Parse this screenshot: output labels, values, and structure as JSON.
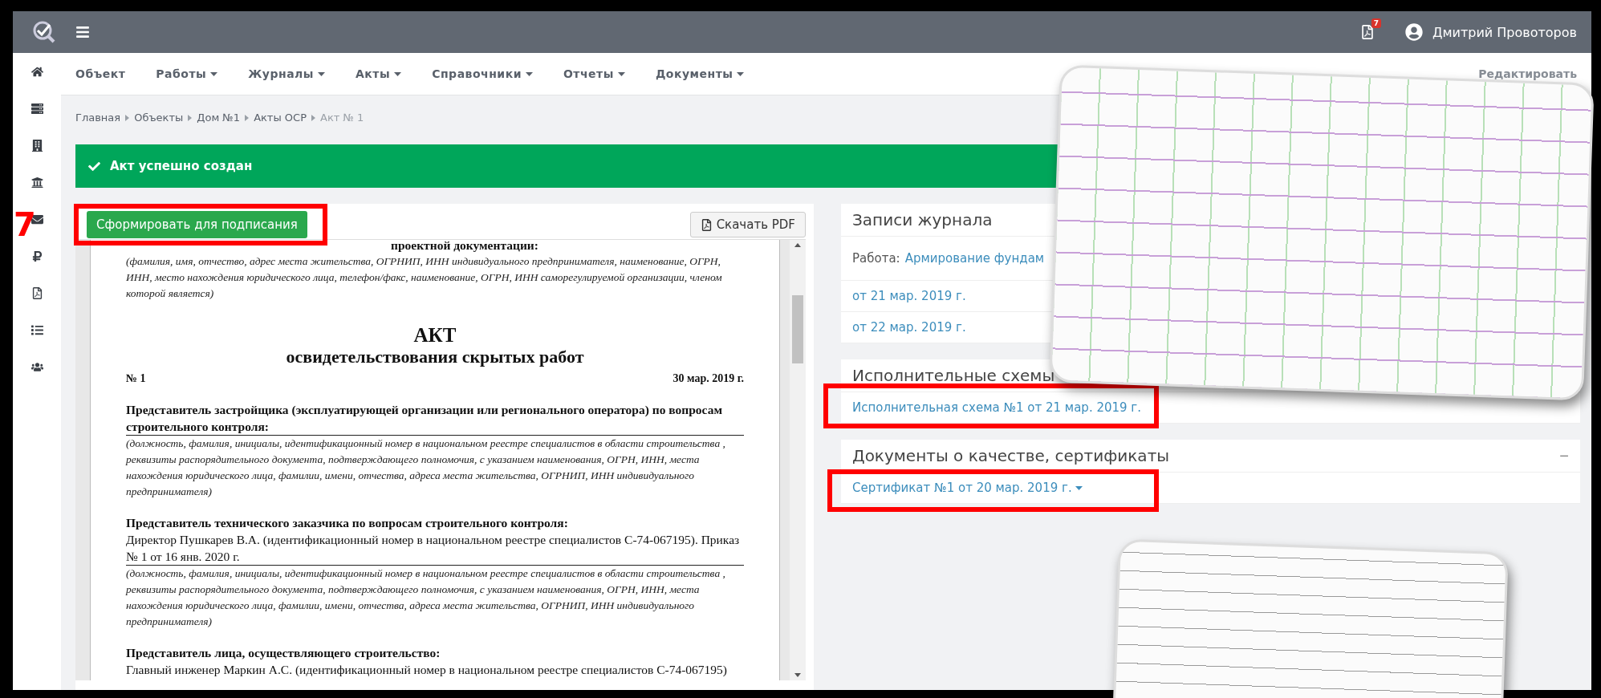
{
  "topbar": {
    "pdf_badge": "7",
    "user_name": "Дмитрий Провоторов"
  },
  "nav": {
    "items": [
      {
        "label": "Объект",
        "has_menu": false
      },
      {
        "label": "Работы",
        "has_menu": true
      },
      {
        "label": "Журналы",
        "has_menu": true
      },
      {
        "label": "Акты",
        "has_menu": true
      },
      {
        "label": "Справочники",
        "has_menu": true
      },
      {
        "label": "Отчеты",
        "has_menu": true
      },
      {
        "label": "Документы",
        "has_menu": true
      }
    ],
    "edit_link": "Редактировать"
  },
  "breadcrumbs": [
    {
      "label": "Главная",
      "current": false
    },
    {
      "label": "Объекты",
      "current": false
    },
    {
      "label": "Дом №1",
      "current": false
    },
    {
      "label": "Акты ОСР",
      "current": false
    },
    {
      "label": "Акт № 1",
      "current": true
    }
  ],
  "alert": "Акт успешно создан",
  "annotation_number": "7",
  "document_panel": {
    "sign_button": "Сформировать для подписания",
    "sign_highlighted": true,
    "pdf_button": "Скачать PDF",
    "blocks": [
      {
        "kind": "heading",
        "text": "проектной документации:"
      },
      {
        "kind": "note",
        "text": "(фамилия, имя, отчество, адрес места жительства, ОГРНИП, ИНН индивидуального предпринимателя, наименование, ОГРН, ИНН, место нахождения юридического лица, телефон/факс, наименование, ОГРН, ИНН саморегулируемой организации, членом которой является)"
      },
      {
        "kind": "title",
        "text": "АКТ"
      },
      {
        "kind": "subtitle",
        "text": "освидетельствования скрытых работ"
      },
      {
        "kind": "numberline",
        "text": "№ 1",
        "date": "30 мар. 2019 г."
      },
      {
        "kind": "heading",
        "text": "Представитель застройщика (эксплуатирующей организации или регионального оператора) по вопросам строительного контроля:"
      },
      {
        "kind": "note",
        "text": "(должность, фамилия, инициалы, идентификационный номер в национальном реестре специалистов в области строительства , реквизиты распорядительного документа, подтверждающего полномочия, с указанием наименования, ОГРН, ИНН, места нахождения юридического лица, фамилии, имени, отчества, адреса места жительства, ОГРНИП, ИНН индивидуального предпринимателя)"
      },
      {
        "kind": "heading",
        "text": "Представитель технического заказчика по вопросам строительного контроля:"
      },
      {
        "kind": "text",
        "text": "Директор Пушкарев В.А. (идентификационный номер в национальном реестре специалистов С-74-067195). Приказ № 1 от 16 янв. 2020 г."
      },
      {
        "kind": "note",
        "text": "(должность, фамилия, инициалы, идентификационный номер в национальном реестре специалистов в области строительства , реквизиты распорядительного документа, подтверждающего полномочия, с указанием наименования, ОГРН, ИНН, места нахождения юридического лица, фамилии, имени, отчества, адреса места жительства, ОГРНИП, ИНН индивидуального предпринимателя)"
      },
      {
        "kind": "heading",
        "text": "Представитель лица, осуществляющего строительство:"
      },
      {
        "kind": "text",
        "text": "Главный инженер Маркин А.С. (идентификационный номер в национальном реестре специалистов С-74-067195)"
      }
    ]
  },
  "journal_panel": {
    "title": "Записи журнала",
    "work_label": "Работа:",
    "work_link": "Армирование фундам",
    "entries": [
      "от 21 мар. 2019 г.",
      "от 22 мар. 2019 г."
    ]
  },
  "schemes_panel": {
    "title": "Исполнительные схемы",
    "links": [
      {
        "label": "Исполнительная схема №1 от 21 мар. 2019 г.",
        "has_menu": false,
        "highlighted": true
      }
    ]
  },
  "quality_panel": {
    "title": "Документы о качестве, сертификаты",
    "collapse": "−",
    "links": [
      {
        "label": "Сертификат №1 от 20 мар. 2019 г.",
        "has_menu": true,
        "highlighted": true
      }
    ]
  }
}
